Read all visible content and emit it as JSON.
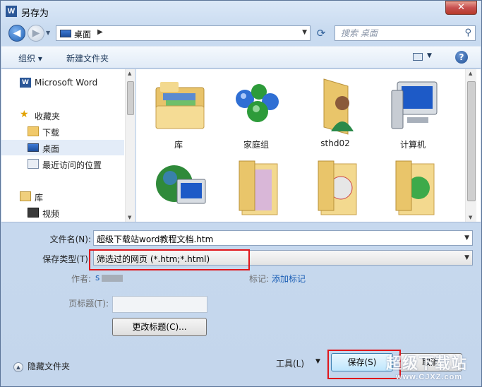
{
  "window": {
    "title": "另存为",
    "app_icon": "W",
    "close_glyph": "✕"
  },
  "nav": {
    "back_glyph": "◀",
    "forward_glyph": "▶"
  },
  "address": {
    "crumb": "桌面",
    "separator": "▶"
  },
  "search": {
    "placeholder": "搜索 桌面"
  },
  "toolbar": {
    "organize": "组织 ▾",
    "new_folder": "新建文件夹"
  },
  "sidebar": {
    "items": [
      {
        "label": "Microsoft Word",
        "icon": "word-icon"
      },
      {
        "label": "收藏夹",
        "icon": "star-icon"
      },
      {
        "label": "下载",
        "icon": "download-folder-icon"
      },
      {
        "label": "桌面",
        "icon": "desktop-icon",
        "selected": true
      },
      {
        "label": "最近访问的位置",
        "icon": "recent-places-icon"
      },
      {
        "label": "库",
        "icon": "library-icon"
      },
      {
        "label": "视频",
        "icon": "video-icon"
      }
    ]
  },
  "files": [
    {
      "label": "库",
      "icon": "library-folder-icon"
    },
    {
      "label": "家庭组",
      "icon": "homegroup-icon"
    },
    {
      "label": "sthd02",
      "icon": "user-folder-icon"
    },
    {
      "label": "计算机",
      "icon": "computer-icon"
    },
    {
      "label": "",
      "icon": "network-icon"
    },
    {
      "label": "",
      "icon": "folder-icon"
    },
    {
      "label": "",
      "icon": "folder-icon"
    },
    {
      "label": "",
      "icon": "folder-icon"
    }
  ],
  "form": {
    "filename_label": "文件名(N):",
    "filename_value": "超级下载站word教程文档.htm",
    "savetype_label": "保存类型(T):",
    "savetype_value": "筛选过的网页 (*.htm;*.html)",
    "author_label": "作者:",
    "author_value": "s",
    "tags_label": "标记:",
    "tags_value": "添加标记",
    "page_title_label": "页标题(T):",
    "change_title_button": "更改标题(C)..."
  },
  "footer": {
    "hide_folders": "隐藏文件夹",
    "tools": "工具(L)",
    "tools_arrow": "▼",
    "save": "保存(S)",
    "cancel": "取消"
  },
  "watermark": {
    "text_big": "超级下载站",
    "text_small": "www.CJXZ.com"
  },
  "colors": {
    "highlight_box": "#e0161b",
    "link": "#1c5fb5",
    "selected_nav": "#e3ecf8"
  }
}
